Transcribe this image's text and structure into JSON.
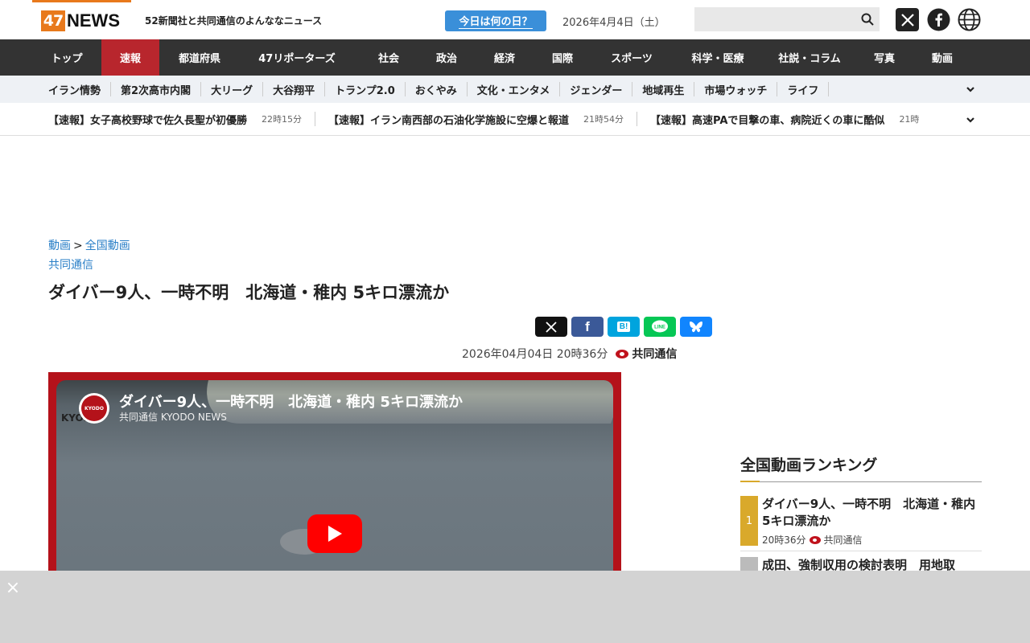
{
  "header": {
    "logo_number": "47",
    "logo_text": "NEWS",
    "tagline": "52新聞社と共同通信のよんななニュース",
    "today_label": "今日は何の日？",
    "date": "2026年4月4日（土）",
    "search_placeholder": ""
  },
  "nav": {
    "items": [
      {
        "label": "トップ",
        "w": 86
      },
      {
        "label": "速報",
        "w": 72,
        "active": true
      },
      {
        "label": "都道府県",
        "w": 100
      },
      {
        "label": "47リポーターズ",
        "w": 142
      },
      {
        "label": "社会",
        "w": 86
      },
      {
        "label": "政治",
        "w": 58
      },
      {
        "label": "経済",
        "w": 86
      }
    ]
  },
  "nav_labels": [
    "トップ",
    "速報",
    "都道府県",
    "47リポーターズ",
    "社会",
    "政治",
    "経済",
    "国際",
    "スポーツ",
    "科学・医療",
    "社説・コラム",
    "写真",
    "動画"
  ],
  "subnav": [
    "イラン情勢",
    "第2次高市内閣",
    "大リーグ",
    "大谷翔平",
    "トランプ2.0",
    "おくやみ",
    "文化・エンタメ",
    "ジェンダー",
    "地域再生",
    "市場ウォッチ",
    "ライフ"
  ],
  "ticker": [
    {
      "title": "【速報】女子高校野球で佐久長聖が初優勝",
      "time": "22時15分"
    },
    {
      "title": "【速報】イラン南西部の石油化学施設に空爆と報道",
      "time": "21時54分"
    },
    {
      "title": "【速報】高速PAで目撃の車、病院近くの車に酷似",
      "time": "21時"
    }
  ],
  "article": {
    "breadcrumb_1": "動画",
    "breadcrumb_sep": ">",
    "breadcrumb_2": "全国動画",
    "source_link": "共同通信",
    "headline": "ダイバー9人、一時不明　北海道・稚内 5キロ漂流か",
    "datetime": "2026年04月04日 20時36分",
    "source": "共同通信"
  },
  "share": {
    "x": "X",
    "facebook": "f",
    "hatena": "B!",
    "line": "LINE",
    "bluesky": "bluesky"
  },
  "video": {
    "title": "ダイバー9人、一時不明　北海道・稚内 5キロ漂流か",
    "channel": "共同通信 KYODO NEWS",
    "avatar_text": "KYODO",
    "watermark": "KYODO"
  },
  "sidebar": {
    "title": "全国動画ランキング",
    "rank1": {
      "num": "1",
      "title": "ダイバー9人、一時不明　北海道・稚内 5キロ漂流か",
      "time": "20時36分",
      "source": "共同通信"
    },
    "rank2": {
      "num": "",
      "title": "成田、強制収用の検討表明　用地取"
    }
  },
  "ad": {
    "close": "×"
  },
  "colors": {
    "accent": "#e8791c",
    "nav_bg": "#333333",
    "active": "#b8262d",
    "link": "#2a7fc7",
    "rank_gold": "#d9a92b"
  }
}
